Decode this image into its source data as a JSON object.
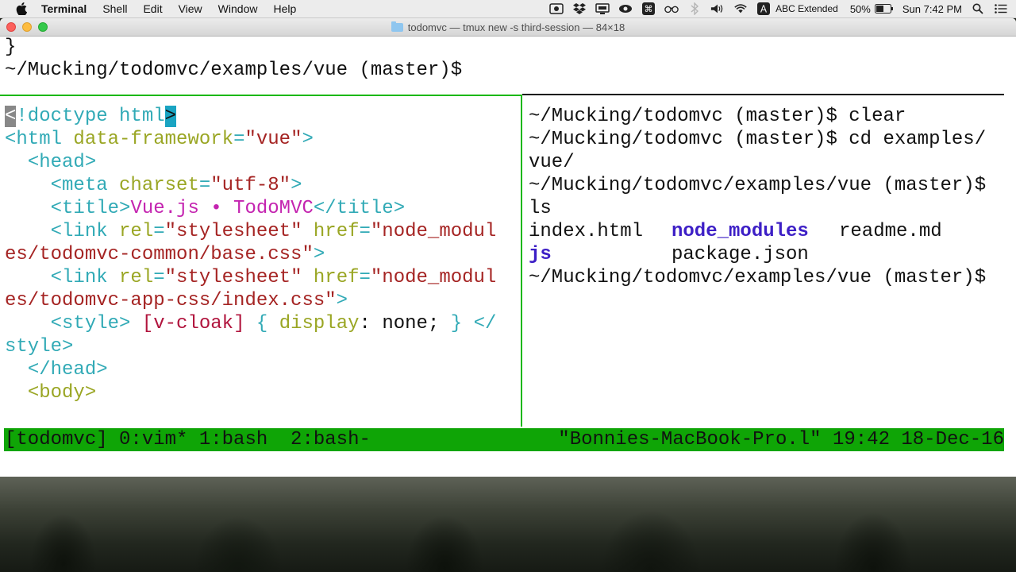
{
  "menubar": {
    "app": "Terminal",
    "items": [
      "Shell",
      "Edit",
      "View",
      "Window",
      "Help"
    ],
    "input_source": "ABC Extended",
    "battery": "50%",
    "clock": "Sun 7:42 PM"
  },
  "window": {
    "title": "todomvc — tmux new -s third-session — 84×18"
  },
  "top_pane": {
    "lines": [
      "}",
      "~/Mucking/todomvc/examples/vue (master)$"
    ]
  },
  "vim": {
    "l1_cursor": "<",
    "l1_body": "!doctype html",
    "l1_end": ">",
    "l2": {
      "open": "<html ",
      "attr": "data-framework",
      "eq": "=",
      "val": "\"vue\"",
      "close": ">"
    },
    "l3": "<head>",
    "l4": {
      "open": "<meta ",
      "attr": "charset",
      "eq": "=",
      "val": "\"utf-8\"",
      "close": ">"
    },
    "l5": {
      "open": "<title>",
      "text": "Vue.js • TodoMVC",
      "close": "</title>"
    },
    "l6": {
      "open": "<link ",
      "attr1": "rel",
      "eq": "=",
      "val1": "\"stylesheet\"",
      "attr2": "href",
      "val2a": "\"node_modul"
    },
    "l7": {
      "val": "es/todomvc-common/base.css\"",
      "close": ">"
    },
    "l8": {
      "open": "<link ",
      "attr1": "rel",
      "eq": "=",
      "val1": "\"stylesheet\"",
      "attr2": "href",
      "val2a": "\"node_modul"
    },
    "l9": {
      "val": "es/todomvc-app-css/index.css\"",
      "close": ">"
    },
    "l10": {
      "open": "<style>",
      "sel": "[v-cloak]",
      "brace_open": "{",
      "prop": "display",
      "colon": ":",
      "value": "none;",
      "brace_close": "}",
      "close": "</"
    },
    "l11": {
      "close": "style>"
    },
    "l12": "</head>",
    "l13": "<body>"
  },
  "bash": {
    "lines": [
      "~/Mucking/todomvc (master)$ clear",
      "~/Mucking/todomvc (master)$ cd examples/",
      "vue/",
      "~/Mucking/todomvc/examples/vue (master)$",
      "ls"
    ],
    "ls_row1": [
      "index.html",
      "node_modules",
      "readme.md"
    ],
    "ls_row2": [
      "js",
      "package.json"
    ],
    "prompt": "~/Mucking/todomvc/examples/vue (master)$"
  },
  "tmux_status": {
    "left": "[todomvc] 0:vim* 1:bash  2:bash-",
    "right": "\"Bonnies-MacBook-Pro.l\" 19:42 18-Dec-16",
    "color": "#0fa506"
  },
  "colors": {
    "pane_border": "#1bb80f",
    "tag": "#31aab6",
    "attribute": "#9aa624",
    "string": "#a52423",
    "directory": "#3d1fc6"
  }
}
